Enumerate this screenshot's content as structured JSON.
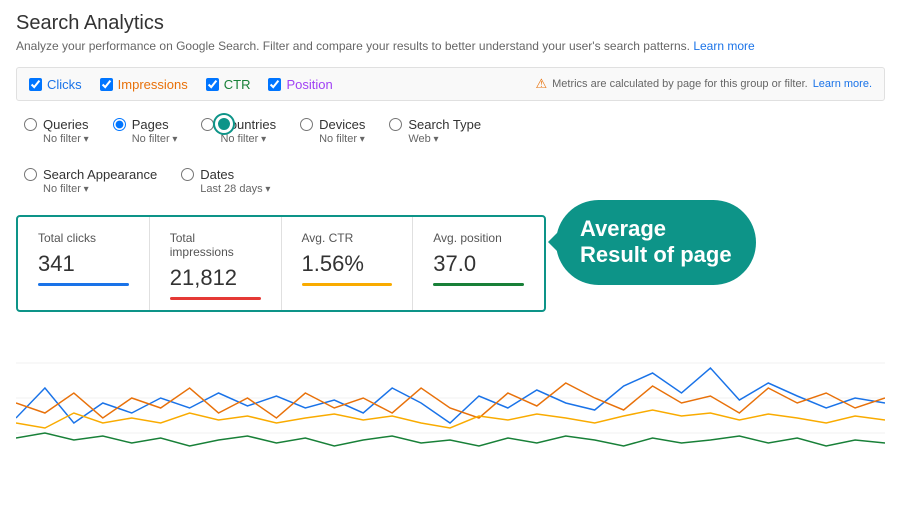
{
  "page": {
    "title": "Search Analytics",
    "description": "Analyze your performance on Google Search. Filter and compare your results to better understand your user's search patterns.",
    "learn_more": "Learn more",
    "learn_more2": "Learn more."
  },
  "metrics": {
    "note": "Metrics are calculated by page for this group or filter.",
    "items": [
      {
        "id": "clicks",
        "label": "Clicks",
        "checked": true,
        "color": "clicks"
      },
      {
        "id": "impressions",
        "label": "Impressions",
        "checked": true,
        "color": "impressions"
      },
      {
        "id": "ctr",
        "label": "CTR",
        "checked": true,
        "color": "ctr"
      },
      {
        "id": "position",
        "label": "Position",
        "checked": true,
        "color": "position"
      }
    ]
  },
  "filters": {
    "row1": [
      {
        "id": "queries",
        "label": "Queries",
        "value": "No filter",
        "active": false
      },
      {
        "id": "pages",
        "label": "Pages",
        "value": "No filter",
        "active": true
      },
      {
        "id": "countries",
        "label": "Countries",
        "value": "No filter",
        "active": false
      },
      {
        "id": "devices",
        "label": "Devices",
        "value": "No filter",
        "active": false
      },
      {
        "id": "search_type",
        "label": "Search Type",
        "value": "Web",
        "active": false
      }
    ],
    "row2": [
      {
        "id": "search_appearance",
        "label": "Search Appearance",
        "value": "No filter",
        "active": false
      },
      {
        "id": "dates",
        "label": "Dates",
        "value": "Last 28 days",
        "active": false
      }
    ]
  },
  "stats": [
    {
      "id": "total_clicks",
      "label": "Total clicks",
      "value": "341",
      "bar": "blue"
    },
    {
      "id": "total_impressions",
      "label": "Total impressions",
      "value": "21,812",
      "bar": "red"
    },
    {
      "id": "avg_ctr",
      "label": "Avg. CTR",
      "value": "1.56%",
      "bar": "orange"
    },
    {
      "id": "avg_position",
      "label": "Avg. position",
      "value": "37.0",
      "bar": "green"
    }
  ],
  "bubble": {
    "text": "Average\nResult of page"
  },
  "chart": {
    "lines": [
      {
        "color": "#1a73e8",
        "label": "Clicks"
      },
      {
        "color": "#e8710a",
        "label": "Impressions"
      },
      {
        "color": "#f9ab00",
        "label": "CTR"
      },
      {
        "color": "#188038",
        "label": "Position"
      }
    ]
  }
}
